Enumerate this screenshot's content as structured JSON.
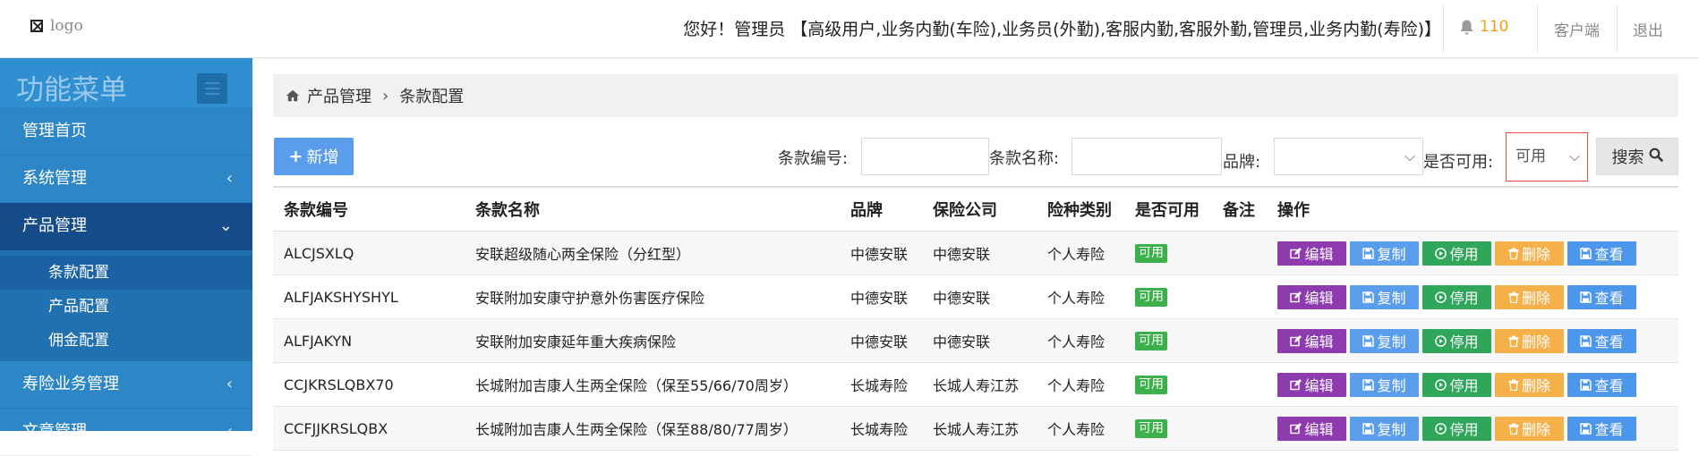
{
  "colors": {
    "sidebar_bg": "#2d86c6",
    "sidebar_active": "#164c8a",
    "primary": "#5a9ded",
    "edit": "#8e3bb0",
    "copy": "#5a9ded",
    "disable": "#2fa65a",
    "delete": "#f5b04a",
    "view": "#4c96eb",
    "available_badge": "#3cb04a",
    "notification": "#f39c12"
  },
  "header": {
    "logo_text": "logo",
    "greeting": "您好！管理员 【高级用户,业务内勤(车险),业务员(外勤),客服内勤,客服外勤,管理员,业务内勤(寿险)】",
    "notification_icon": "bell-icon",
    "notification_count": "110",
    "client_link": "客户端",
    "logout_link": "退出"
  },
  "sidebar": {
    "title": "功能菜单",
    "toggle_icon": "hamburger-icon",
    "items": [
      {
        "label": "管理首页"
      },
      {
        "label": "系统管理",
        "chevron": "‹"
      },
      {
        "label": "产品管理",
        "chevron": "⌄"
      },
      {
        "label": "寿险业务管理",
        "chevron": "‹"
      },
      {
        "label": "文章管理",
        "chevron": "‹"
      }
    ],
    "sub_items": [
      {
        "label": "条款配置",
        "active": true
      },
      {
        "label": "产品配置"
      },
      {
        "label": "佣金配置"
      }
    ]
  },
  "breadcrumb": {
    "home_icon": "home-icon",
    "parent": "产品管理",
    "separator": "›",
    "current": "条款配置"
  },
  "toolbar": {
    "add_label": "新增",
    "add_icon": "plus-icon",
    "code_label": "条款编号:",
    "name_label": "条款名称:",
    "brand_label": "品牌:",
    "available_label": "是否可用:",
    "available_value": "可用",
    "search_label": "搜索",
    "search_icon": "search-icon"
  },
  "table": {
    "headers": [
      "条款编号",
      "条款名称",
      "品牌",
      "保险公司",
      "险种类别",
      "是否可用",
      "备注",
      "操作"
    ],
    "actions": [
      {
        "label": "编辑",
        "icon": "edit-icon"
      },
      {
        "label": "复制",
        "icon": "save-icon"
      },
      {
        "label": "停用",
        "icon": "power-icon"
      },
      {
        "label": "删除",
        "icon": "trash-icon"
      },
      {
        "label": "查看",
        "icon": "save-icon"
      }
    ],
    "rows": [
      {
        "code": "ALCJSXLQ",
        "name": "安联超级随心两全保险（分红型）",
        "brand": "中德安联",
        "company": "中德安联",
        "category": "个人寿险",
        "status": "可用",
        "remark": ""
      },
      {
        "code": "ALFJAKSHYSHYL",
        "name": "安联附加安康守护意外伤害医疗保险",
        "brand": "中德安联",
        "company": "中德安联",
        "category": "个人寿险",
        "status": "可用",
        "remark": ""
      },
      {
        "code": "ALFJAKYN",
        "name": "安联附加安康延年重大疾病保险",
        "brand": "中德安联",
        "company": "中德安联",
        "category": "个人寿险",
        "status": "可用",
        "remark": ""
      },
      {
        "code": "CCJKRSLQBX70",
        "name": "长城附加吉康人生两全保险（保至55/66/70周岁）",
        "brand": "长城寿险",
        "company": "长城人寿江苏",
        "category": "个人寿险",
        "status": "可用",
        "remark": ""
      },
      {
        "code": "CCFJJKRSLQBX",
        "name": "长城附加吉康人生两全保险（保至88/80/77周岁）",
        "brand": "长城寿险",
        "company": "长城人寿江苏",
        "category": "个人寿险",
        "status": "可用",
        "remark": ""
      }
    ]
  }
}
